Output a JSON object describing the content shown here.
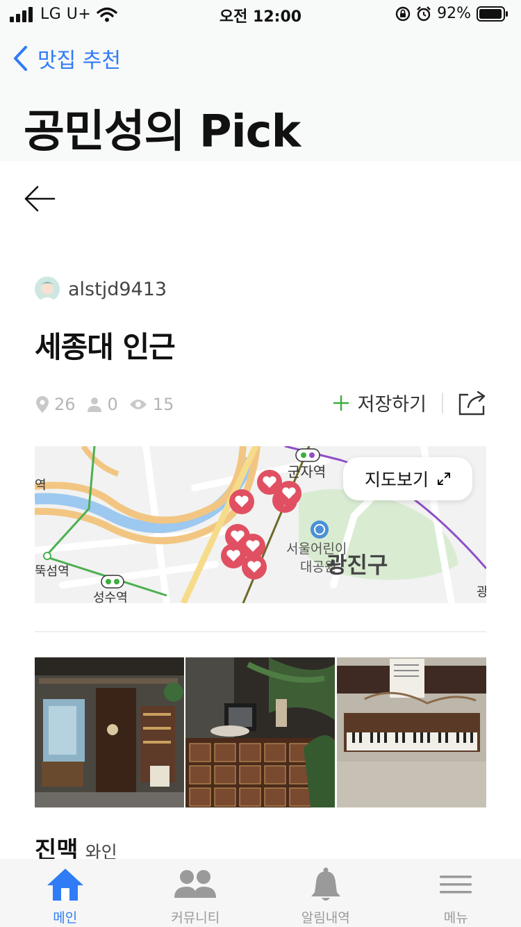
{
  "status_bar": {
    "carrier": "LG U+",
    "time": "오전 12:00",
    "battery": "92%"
  },
  "nav": {
    "back_label": "맛집 추천",
    "title": "공민성의 Pick"
  },
  "author": {
    "name": "alstjd9413"
  },
  "list": {
    "title": "세종대 인근"
  },
  "stats": {
    "places": "26",
    "followers": "0",
    "views": "15"
  },
  "actions": {
    "save_label": "저장하기"
  },
  "map": {
    "button_label": "지도보기",
    "labels": {
      "station1": "군자역",
      "station2": "성수역",
      "station3": "뚝섬역",
      "park_line1": "서울어린이",
      "park_line2": "대공원",
      "district": "광진구",
      "edge_right": "광",
      "edge_left": "역"
    }
  },
  "place": {
    "name": "진맥",
    "category": "와인"
  },
  "tabs": [
    {
      "label": "메인",
      "icon": "home-icon"
    },
    {
      "label": "커뮤니티",
      "icon": "people-icon"
    },
    {
      "label": "알림내역",
      "icon": "bell-icon"
    },
    {
      "label": "메뉴",
      "icon": "menu-icon"
    }
  ],
  "colors": {
    "accent": "#2f7cf6",
    "pin": "#e05062",
    "plus": "#3dae3d"
  }
}
